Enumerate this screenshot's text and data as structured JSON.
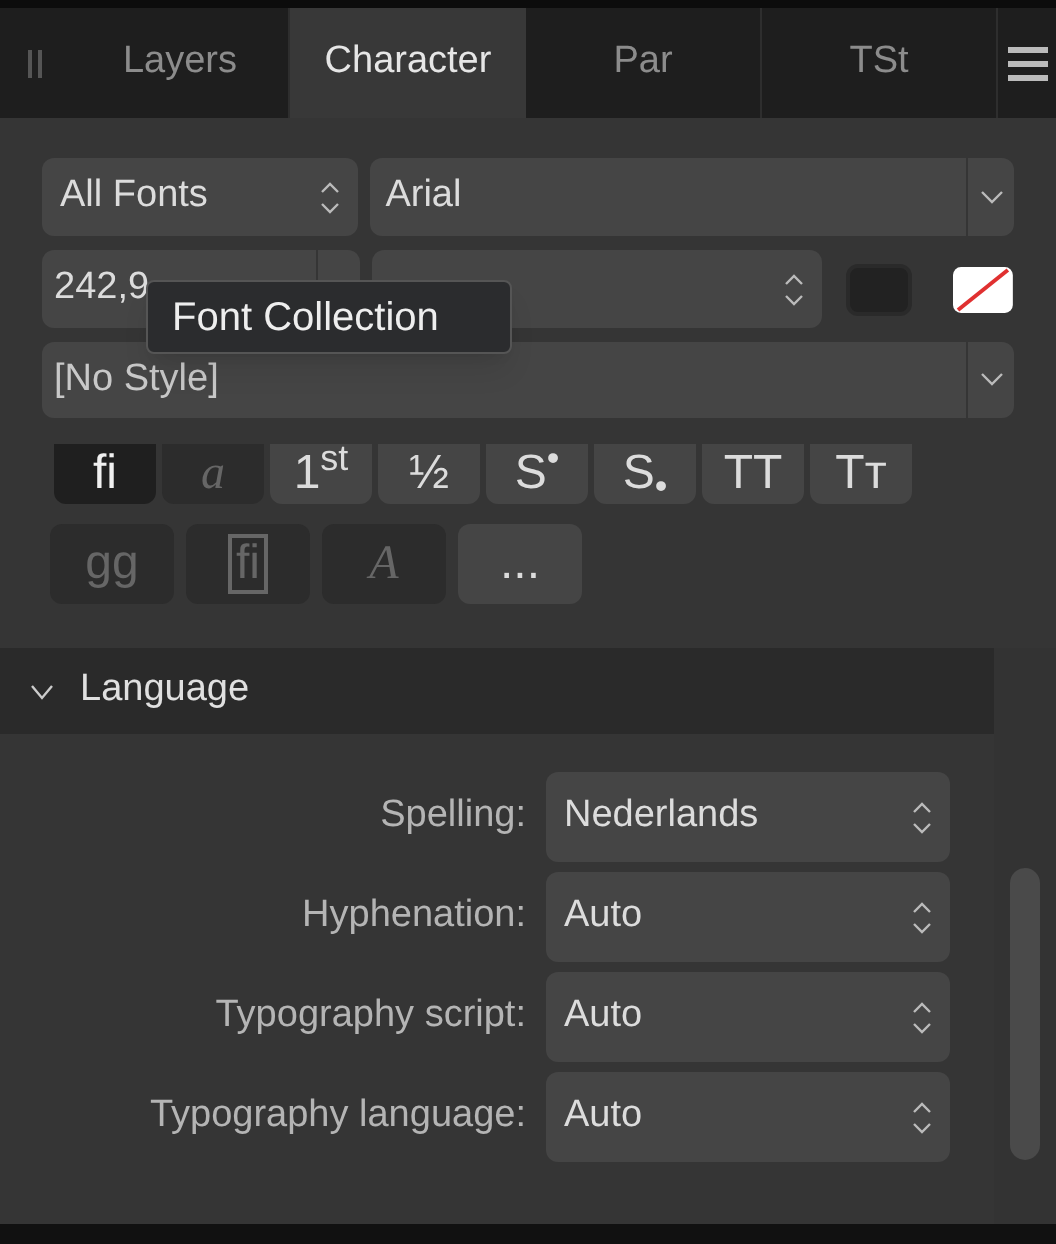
{
  "tabs": [
    {
      "label": "Layers",
      "selected": false
    },
    {
      "label": "Character",
      "selected": true
    },
    {
      "label": "Par",
      "selected": false
    },
    {
      "label": "TSt",
      "selected": false
    }
  ],
  "font_collection": {
    "value": "All Fonts"
  },
  "font_family": {
    "value": "Arial"
  },
  "font_size": {
    "value": "242,9"
  },
  "tooltip": "Font Collection",
  "style": {
    "value": "[No Style]"
  },
  "glyph_rows": [
    [
      {
        "label": "fi",
        "selected": true,
        "disabled": false
      },
      {
        "label": "a",
        "selected": false,
        "disabled": true
      },
      {
        "label": "1$^{st}$",
        "selected": false,
        "disabled": false
      },
      {
        "label": "½",
        "selected": false,
        "disabled": false
      },
      {
        "label": "S$^{•}$",
        "selected": false,
        "disabled": false
      },
      {
        "label": "S$_{•}$",
        "selected": false,
        "disabled": false
      },
      {
        "label": "TT",
        "selected": false,
        "disabled": false
      },
      {
        "label": "Tᴛ",
        "selected": false,
        "disabled": false
      }
    ],
    [
      {
        "label": "gg",
        "selected": false,
        "disabled": true
      },
      {
        "label": "fi",
        "selected": false,
        "disabled": true,
        "framed": true
      },
      {
        "label": "A",
        "selected": false,
        "disabled": true
      },
      {
        "label": "...",
        "selected": false,
        "disabled": false
      }
    ]
  ],
  "language": {
    "title": "Language",
    "expanded": true,
    "rows": [
      {
        "label": "Spelling:",
        "value": "Nederlands"
      },
      {
        "label": "Hyphenation:",
        "value": "Auto"
      },
      {
        "label": "Typography script:",
        "value": "Auto"
      },
      {
        "label": "Typography language:",
        "value": "Auto"
      }
    ]
  }
}
